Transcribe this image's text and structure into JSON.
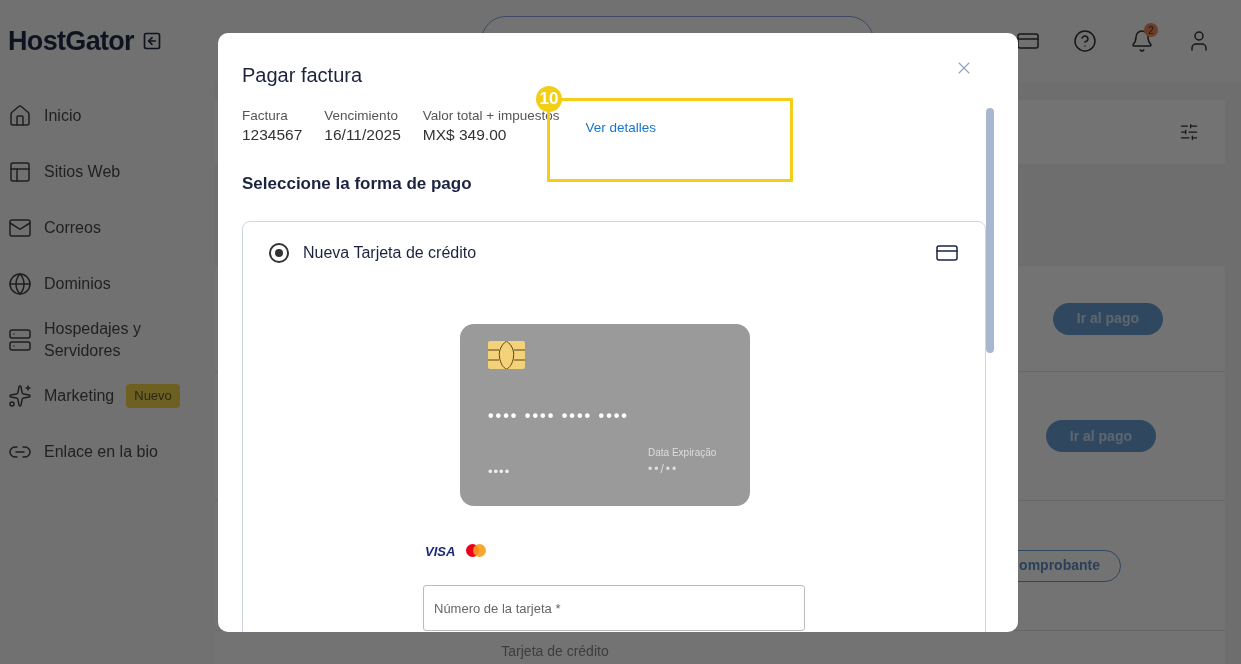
{
  "sidebar": {
    "logo": "HostGator",
    "items": [
      {
        "label": "Inicio",
        "kind": "home"
      },
      {
        "label": "Sitios Web",
        "kind": "sites"
      },
      {
        "label": "Correos",
        "kind": "mail"
      },
      {
        "label": "Dominios",
        "kind": "domains"
      },
      {
        "label": "Hospedajes y Servidores",
        "kind": "hosting"
      },
      {
        "label": "Marketing",
        "kind": "marketing",
        "badge": "Nuevo"
      },
      {
        "label": "Enlace en la bio",
        "kind": "link"
      }
    ]
  },
  "header": {
    "notification_count": "2"
  },
  "background": {
    "rows": [
      {
        "button": "Ir al pago",
        "kind": "primary"
      },
      {
        "button": "Ir al pago",
        "kind": "primary"
      },
      {
        "button": "omprobante",
        "kind": "outline"
      }
    ],
    "footer_text": "Tarjeta de crédito"
  },
  "modal": {
    "title": "Pagar factura",
    "fields": [
      {
        "label": "Factura",
        "value": "1234567"
      },
      {
        "label": "Vencimiento",
        "value": "16/11/2025"
      },
      {
        "label": "Valor total + impuestos",
        "value": "MX$ 349.00"
      }
    ],
    "details_link": "Ver detalles",
    "heading": "Seleccione la forma de pago",
    "methods": [
      {
        "label": "Nueva Tarjeta de crédito",
        "selected": true
      }
    ],
    "card": {
      "number": "•••• •••• •••• ••••",
      "cvv": "••••",
      "expiry_label": "Data Expiração",
      "expiry": "••/••"
    },
    "brands": [
      "VISA"
    ],
    "card_number_field": {
      "placeholder": "Número de la tarjeta *"
    }
  },
  "annotation": {
    "number": "10"
  }
}
